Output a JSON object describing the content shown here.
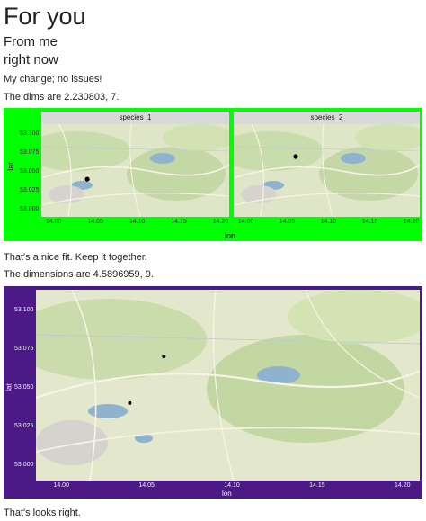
{
  "header": {
    "title": "For you",
    "subtitle1": "From me",
    "subtitle2": "right now"
  },
  "text": {
    "p1": "My change; no issues!",
    "p2": "The dims are 2.230803, 7.",
    "p3": "That's a nice fit. Keep it together.",
    "p4": "The dimensions are 4.5896959, 9.",
    "p5": "That's looks right."
  },
  "chart_data": [
    {
      "type": "scatter",
      "facets": [
        "species_1",
        "species_2"
      ],
      "xlabel": "lon",
      "ylabel": "lat",
      "xlim": [
        13.985,
        14.21
      ],
      "ylim": [
        52.99,
        53.113
      ],
      "xticks": [
        "14.00",
        "14.05",
        "14.10",
        "14.15",
        "14.20"
      ],
      "xtick_values": [
        14.0,
        14.05,
        14.1,
        14.15,
        14.2
      ],
      "yticks": [
        "53.100",
        "53.075",
        "53.050",
        "53.025",
        "53.000"
      ],
      "ytick_values": [
        53.1,
        53.075,
        53.05,
        53.025,
        53.0
      ],
      "points": [
        {
          "facet": "species_1",
          "x": 14.04,
          "y": 53.04
        },
        {
          "facet": "species_2",
          "x": 14.06,
          "y": 53.07
        }
      ],
      "background": "#00ff00"
    },
    {
      "type": "scatter",
      "xlabel": "lon",
      "ylabel": "lat",
      "xlim": [
        13.985,
        14.21
      ],
      "ylim": [
        52.99,
        53.113
      ],
      "xticks": [
        "14.00",
        "14.05",
        "14.10",
        "14.15",
        "14.20"
      ],
      "xtick_values": [
        14.0,
        14.05,
        14.1,
        14.15,
        14.2
      ],
      "yticks": [
        "53.100",
        "53.075",
        "53.050",
        "53.025",
        "53.000"
      ],
      "ytick_values": [
        53.1,
        53.075,
        53.05,
        53.025,
        53.0
      ],
      "points": [
        {
          "x": 14.04,
          "y": 53.04
        },
        {
          "x": 14.06,
          "y": 53.07
        }
      ],
      "background": "#4b1a86"
    }
  ]
}
